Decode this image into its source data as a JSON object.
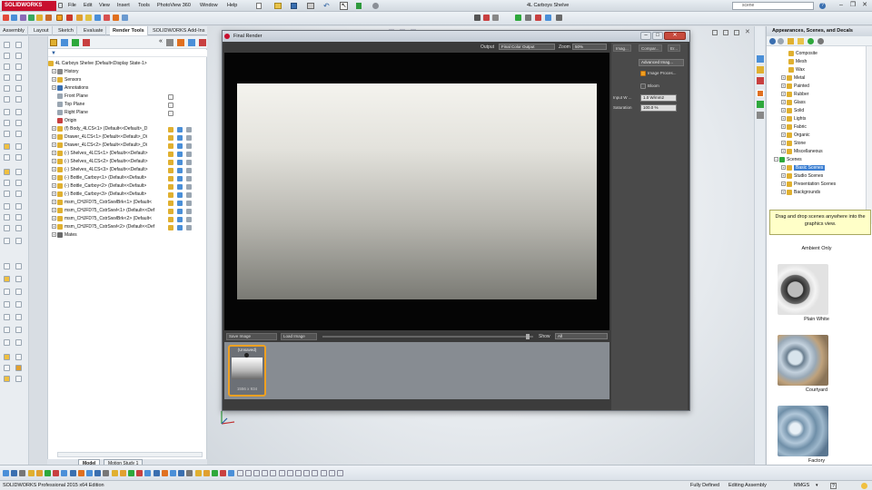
{
  "app": {
    "logo_text": "SOLIDWORKS",
    "document_title": "4L Carboys Shelve",
    "search_value": "scene"
  },
  "menu": [
    "File",
    "Edit",
    "View",
    "Insert",
    "Tools",
    "PhotoView 360",
    "Window",
    "Help"
  ],
  "command_tabs": [
    "Assembly",
    "Layout",
    "Sketch",
    "Evaluate",
    "Render Tools",
    "SOLIDWORKS Add-Ins"
  ],
  "active_command_tab": "Render Tools",
  "tree": {
    "root": "4L Carboys Shelve  (Default<Display State-1>",
    "items": [
      {
        "label": "History",
        "icon": "history-icon"
      },
      {
        "label": "Sensors",
        "icon": "sensor-icon"
      },
      {
        "label": "Annotations",
        "icon": "annotation-icon"
      },
      {
        "label": "Front Plane",
        "icon": "plane-icon"
      },
      {
        "label": "Top Plane",
        "icon": "plane-icon"
      },
      {
        "label": "Right Plane",
        "icon": "plane-icon"
      },
      {
        "label": "Origin",
        "icon": "origin-icon"
      },
      {
        "label": "(f) Body_4LCS<1> (Default<<Default>_D",
        "icon": "part-icon"
      },
      {
        "label": "Drawer_4LCS<1> (Default<<Default>_Di",
        "icon": "part-icon"
      },
      {
        "label": "Drawer_4LCS<2> (Default<<Default>_Di",
        "icon": "part-icon"
      },
      {
        "label": "(-) Shelves_4LCS<1> (Default<<Default>",
        "icon": "part-icon"
      },
      {
        "label": "(-) Shelves_4LCS<2> (Default<<Default>",
        "icon": "part-icon"
      },
      {
        "label": "(-) Shelves_4LCS<3> (Default<<Default>",
        "icon": "part-icon"
      },
      {
        "label": "(-) Bottle_Carboy<1> (Default<<Default>",
        "icon": "part-icon"
      },
      {
        "label": "(-) Bottle_Carboy<2> (Default<<Default>",
        "icon": "part-icon"
      },
      {
        "label": "(-) Bottle_Carboy<3> (Default<<Default>",
        "icon": "part-icon"
      },
      {
        "label": "msm_CHJFD75_CstrSwvlBrk<1> (Default<",
        "icon": "part-icon"
      },
      {
        "label": "msm_CHJFD75_CstrSwvl<1> (Default<<Def",
        "icon": "part-icon"
      },
      {
        "label": "msm_CHJFD75_CstrSwvlBrk<2> (Default<",
        "icon": "part-icon"
      },
      {
        "label": "msm_CHJFD75_CstrSwvl<2> (Default<<Def",
        "icon": "part-icon"
      },
      {
        "label": "Mates",
        "icon": "mates-icon"
      }
    ]
  },
  "model_tabs": [
    "Model",
    "Motion Study 1"
  ],
  "render": {
    "title": "Final Render",
    "output_label": "Output",
    "output_value": "Final Color Output",
    "zoom_label": "Zoom",
    "zoom_value": "50%",
    "save_image": "Save Image",
    "load_image": "Load Image",
    "show_label": "Show",
    "show_value": "All",
    "thumb_label": "(Unsaved)",
    "thumb_size": "1556 x 934",
    "side_tabs": [
      "Imag...",
      "Compar...",
      "Er..."
    ],
    "advanced_btn": "Advanced Imag...",
    "image_processing": "Image Proces...",
    "image_processing_checked": true,
    "bloom": "Bloom",
    "bloom_checked": false,
    "input_w_label": "Input W ...",
    "input_w_value": "1.0 W/mm2",
    "saturation_label": "Saturation",
    "saturation_value": "100.0 %"
  },
  "appearances": {
    "title": "Appearances, Scenes, and Decals",
    "items": [
      {
        "label": "Composite",
        "level": 2
      },
      {
        "label": "Mesh",
        "level": 2
      },
      {
        "label": "Wax",
        "level": 2
      },
      {
        "label": "Metal",
        "level": 1
      },
      {
        "label": "Painted",
        "level": 1
      },
      {
        "label": "Rubber",
        "level": 1
      },
      {
        "label": "Glass",
        "level": 1
      },
      {
        "label": "Solid",
        "level": 1
      },
      {
        "label": "Lights",
        "level": 1
      },
      {
        "label": "Fabric",
        "level": 1
      },
      {
        "label": "Organic",
        "level": 1
      },
      {
        "label": "Stone",
        "level": 1
      },
      {
        "label": "Miscellaneous",
        "level": 1
      },
      {
        "label": "Scenes",
        "level": 0
      },
      {
        "label": "Basic Scenes",
        "level": 1
      },
      {
        "label": "Studio Scenes",
        "level": 1
      },
      {
        "label": "Presentation Scenes",
        "level": 1
      },
      {
        "label": "Backgrounds",
        "level": 1
      }
    ],
    "selected": "Basic Scenes",
    "tip": "Drag and drop scenes anywhere into the graphics view.",
    "scenes": [
      "Ambient Only",
      "Plain White",
      "Courtyard",
      "Factory"
    ]
  },
  "status": {
    "app_edition": "SOLIDWORKS Professional 2015 x64 Edition",
    "state": "Fully Defined",
    "mode": "Editing Assembly",
    "units": "MMGS"
  },
  "colors": {
    "brand": "#c8102e",
    "highlight": "#3c7fd2",
    "thumb_border": "#f0a020"
  }
}
